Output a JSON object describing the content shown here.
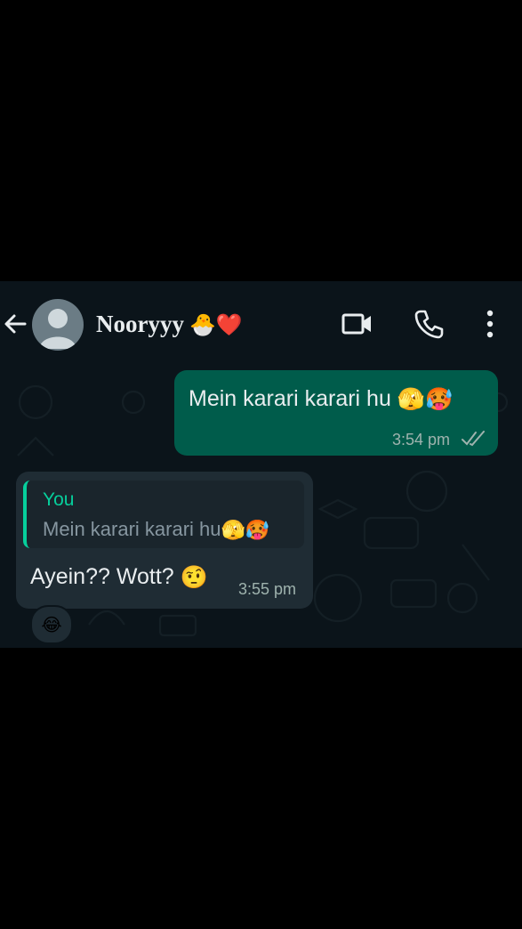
{
  "header": {
    "contact_name": "Nooryyy",
    "name_emojis": "🐣❤️",
    "icons": [
      "back-arrow-icon",
      "avatar",
      "video-call-icon",
      "voice-call-icon",
      "more-options-icon"
    ]
  },
  "messages": [
    {
      "direction": "outgoing",
      "text": "Mein karari karari hu",
      "emojis": "🫣🥵",
      "time": "3:54 pm",
      "status": "read-ticks"
    },
    {
      "direction": "incoming",
      "reply_to": {
        "sender": "You",
        "text": "Mein karari karari hu",
        "emojis": "🫣🥵"
      },
      "text": "Ayein?? Wott?",
      "emojis": "🤨",
      "time": "3:55 pm",
      "reaction": "😂"
    }
  ],
  "colors": {
    "background": "#0b141a",
    "outgoing_bubble": "#005c4b",
    "incoming_bubble": "#1f2c34",
    "accent": "#06cf9c",
    "text": "#e9edef"
  }
}
